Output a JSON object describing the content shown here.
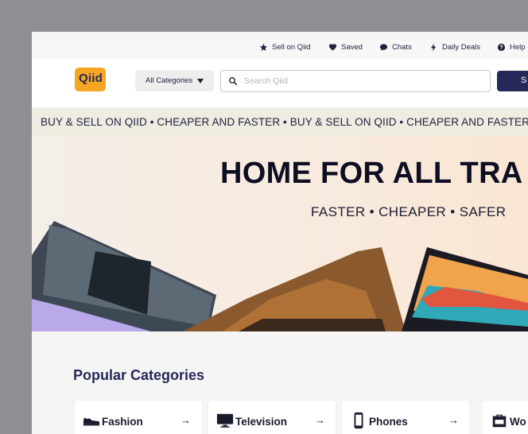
{
  "util_bar": {
    "items": [
      {
        "label": "Sell on Qiid",
        "icon": "star-icon"
      },
      {
        "label": "Saved",
        "icon": "heart-icon"
      },
      {
        "label": "Chats",
        "icon": "chat-bubble-icon"
      },
      {
        "label": "Daily Deals",
        "icon": "lightning-icon"
      },
      {
        "label": "Help",
        "icon": "help-circle-icon"
      }
    ]
  },
  "header": {
    "logo_text": "Qiid",
    "category_select": "All Categories",
    "search_placeholder": "Search Qiid",
    "search_button": "S"
  },
  "marquee": {
    "text": "BUY & SELL ON QIID  •  CHEAPER AND FASTER  •  BUY & SELL ON QIID  •  CHEAPER AND FASTER"
  },
  "hero": {
    "title": "HOME FOR ALL TRA",
    "subtitle": "FASTER • CHEAPER • SAFER"
  },
  "categories": {
    "title": "Popular Categories",
    "items": [
      {
        "label": "Fashion",
        "icon": "sneaker-icon"
      },
      {
        "label": "Television",
        "icon": "tv-icon"
      },
      {
        "label": "Phones",
        "icon": "phone-icon"
      },
      {
        "label": "Wo",
        "icon": "briefcase-icon"
      }
    ]
  },
  "colors": {
    "brand_navy": "#27285a",
    "brand_orange": "#f6a623",
    "marquee_bg": "#efece2"
  }
}
